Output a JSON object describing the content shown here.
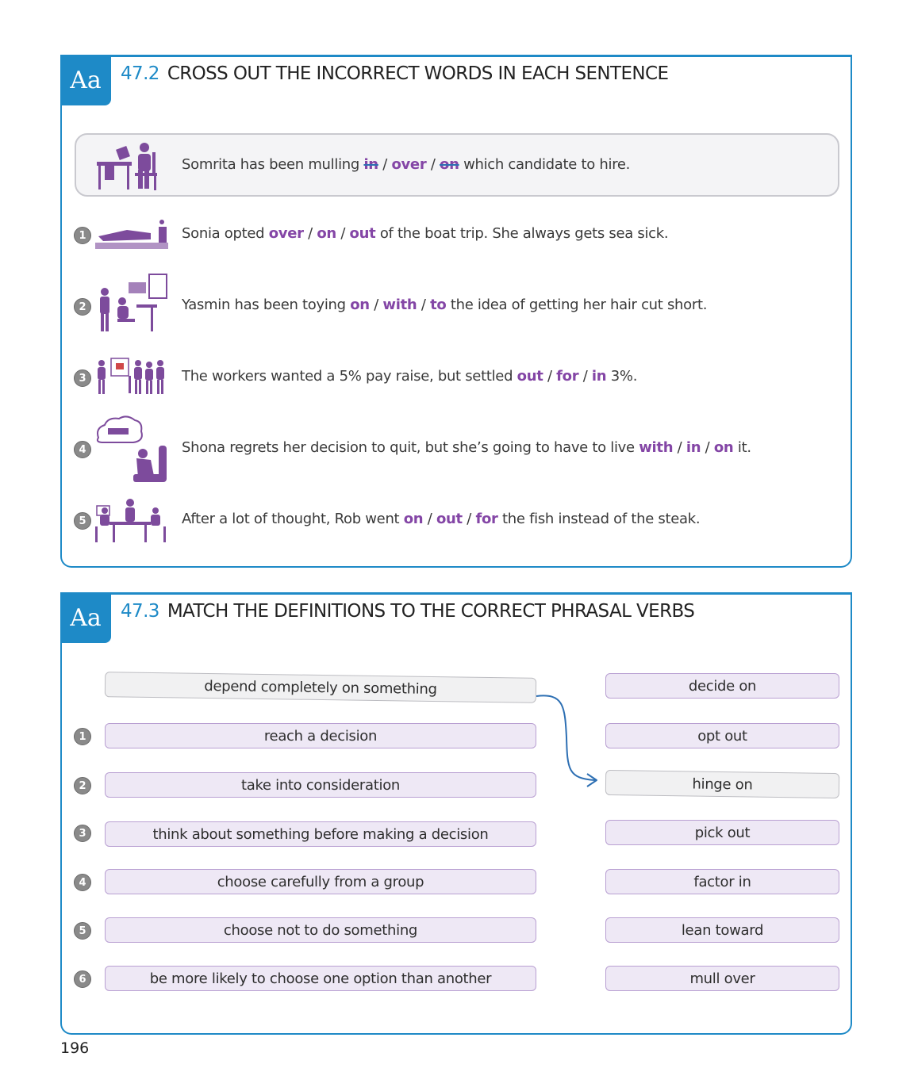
{
  "page_number": "196",
  "section1": {
    "badge": "Aa",
    "number": "47.2",
    "title": "CROSS OUT THE INCORRECT WORDS IN EACH SENTENCE",
    "example": {
      "before": "Somrita has been mulling",
      "options": [
        "in",
        "over",
        "on"
      ],
      "crossed": [
        true,
        false,
        true
      ],
      "after": "which candidate to hire."
    },
    "items": [
      {
        "num": "1",
        "before": "Sonia opted",
        "options": [
          "over",
          "on",
          "out"
        ],
        "after": "of the boat trip. She always gets sea sick."
      },
      {
        "num": "2",
        "before": "Yasmin has been toying",
        "options": [
          "on",
          "with",
          "to"
        ],
        "after": "the idea of getting her hair cut short."
      },
      {
        "num": "3",
        "before": "The workers wanted a 5% pay raise, but settled",
        "options": [
          "out",
          "for",
          "in"
        ],
        "after": "3%."
      },
      {
        "num": "4",
        "before": "Shona regrets her decision to quit, but she’s going to have to live",
        "options": [
          "with",
          "in",
          "on"
        ],
        "after": "it."
      },
      {
        "num": "5",
        "before": "After a lot of thought, Rob went",
        "options": [
          "on",
          "out",
          "for"
        ],
        "after": "the fish instead of the steak."
      }
    ],
    "separator": "/"
  },
  "section2": {
    "badge": "Aa",
    "number": "47.3",
    "title": "MATCH THE DEFINITIONS TO THE CORRECT PHRASAL VERBS",
    "example_definition": "depend completely on something",
    "definitions": [
      {
        "num": "1",
        "text": "reach a decision"
      },
      {
        "num": "2",
        "text": "take into consideration"
      },
      {
        "num": "3",
        "text": "think about something before making a decision"
      },
      {
        "num": "4",
        "text": "choose carefully from a group"
      },
      {
        "num": "5",
        "text": "choose not to do something"
      },
      {
        "num": "6",
        "text": "be more likely to choose one option than another"
      }
    ],
    "phrasal_verbs": [
      "decide on",
      "opt out",
      "hinge on",
      "pick out",
      "factor in",
      "lean toward",
      "mull over"
    ],
    "example_answer_index": 2
  },
  "colors": {
    "accent_blue": "#1e8ac7",
    "option_purple": "#8446a6",
    "pill_fill": "#eee8f5",
    "strike_blue": "#2d6fb3"
  }
}
